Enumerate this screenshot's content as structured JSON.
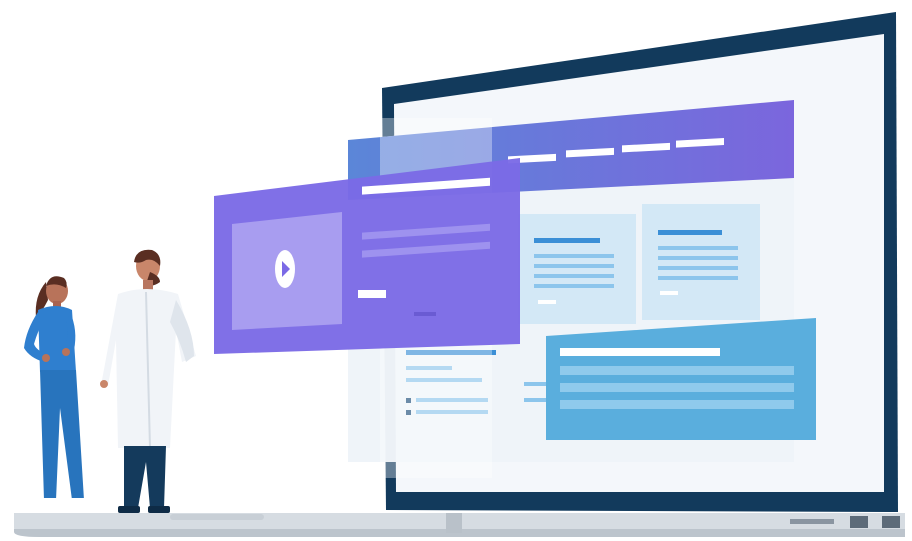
{
  "illustration": {
    "subject": "laptop-with-floating-web-ui-and-two-medical-professionals",
    "colors": {
      "laptop_frame": "#123a5c",
      "laptop_base": "#cfd6dc",
      "screen_bg": "#f4f7fb",
      "header_gradient_start": "#5b86d8",
      "header_gradient_end": "#7b66dd",
      "purple_panel": "#7b6ae6",
      "purple_media": "#a89df0",
      "card_light_blue": "#d3e8f6",
      "card_line_blue": "#5fb2e2",
      "blue_panel": "#5aaedd",
      "white_bar": "#ffffff",
      "nurse_scrubs": "#2f7fcf",
      "nurse_skin": "#b8735a",
      "doctor_coat": "#f1f4f8",
      "doctor_trousers": "#143a5c",
      "hair": "#5a2e22"
    },
    "icons": [
      "play-icon"
    ],
    "people": [
      "nurse-figure",
      "doctor-figure"
    ]
  }
}
